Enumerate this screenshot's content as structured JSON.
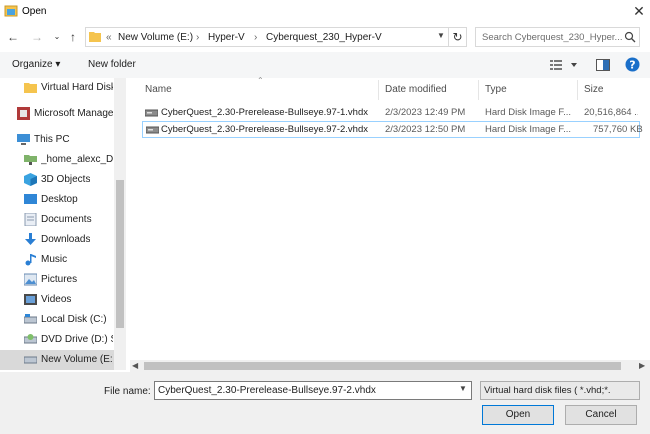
{
  "window": {
    "title": "Open"
  },
  "address": {
    "prefix": "«",
    "crumbs": [
      "New Volume (E:)",
      "Hyper-V",
      "Cyberquest_230_Hyper-V"
    ],
    "separator": "›"
  },
  "search": {
    "placeholder": "Search Cyberquest_230_Hyper..."
  },
  "toolbar": {
    "organize": "Organize ▾",
    "new_folder": "New folder"
  },
  "sidebar": {
    "items": [
      {
        "label": "Virtual Hard Disk",
        "icon": "folder-icon"
      },
      {
        "label": "Microsoft Manage",
        "icon": "app-icon"
      },
      {
        "label": "This PC",
        "icon": "computer-icon"
      },
      {
        "label": "_home_alexc_Do",
        "icon": "network-folder-icon"
      },
      {
        "label": "3D Objects",
        "icon": "cube-icon"
      },
      {
        "label": "Desktop",
        "icon": "desktop-icon"
      },
      {
        "label": "Documents",
        "icon": "documents-icon"
      },
      {
        "label": "Downloads",
        "icon": "download-icon"
      },
      {
        "label": "Music",
        "icon": "music-icon"
      },
      {
        "label": "Pictures",
        "icon": "pictures-icon"
      },
      {
        "label": "Videos",
        "icon": "videos-icon"
      },
      {
        "label": "Local Disk (C:)",
        "icon": "drive-icon"
      },
      {
        "label": "DVD Drive (D:) SS",
        "icon": "dvd-icon"
      },
      {
        "label": "New Volume (E:)",
        "icon": "drive-icon"
      }
    ]
  },
  "columns": {
    "name": "Name",
    "date": "Date modified",
    "type": "Type",
    "size": "Size"
  },
  "files": [
    {
      "name": "CyberQuest_2.30-Prerelease-Bullseye.97-1.vhdx",
      "date": "2/3/2023 12:49 PM",
      "type": "Hard Disk Image F...",
      "size": "20,516,864 ..."
    },
    {
      "name": "CyberQuest_2.30-Prerelease-Bullseye.97-2.vhdx",
      "date": "2/3/2023 12:50 PM",
      "type": "Hard Disk Image F...",
      "size": "757,760 KB"
    }
  ],
  "bottom": {
    "file_name_label": "File name:",
    "file_name_value": "CyberQuest_2.30-Prerelease-Bullseye.97-2.vhdx",
    "filter": "Virtual hard disk files  ( *.vhd;*.",
    "open": "Open",
    "cancel": "Cancel"
  },
  "colors": {
    "accent": "#0078d7",
    "folder": "#f5c44e",
    "selection_border": "#99d1ff"
  }
}
